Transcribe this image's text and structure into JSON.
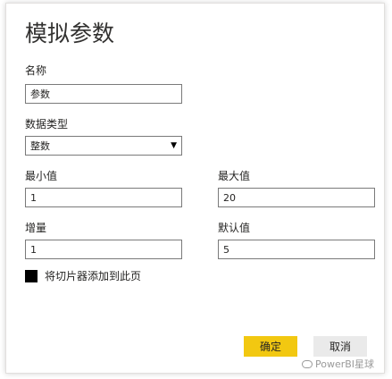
{
  "dialog": {
    "title": "模拟参数",
    "name_label": "名称",
    "name_value": "参数",
    "type_label": "数据类型",
    "type_value": "整数",
    "min_label": "最小值",
    "min_value": "1",
    "max_label": "最大值",
    "max_value": "20",
    "step_label": "增量",
    "step_value": "1",
    "default_label": "默认值",
    "default_value": "5",
    "slicer_label": "将切片器添加到此页",
    "ok_label": "确定",
    "cancel_label": "取消"
  },
  "watermark": {
    "text": "PowerBI星球"
  },
  "colors": {
    "accent": "#f2c811",
    "checkbox": "#000000"
  }
}
